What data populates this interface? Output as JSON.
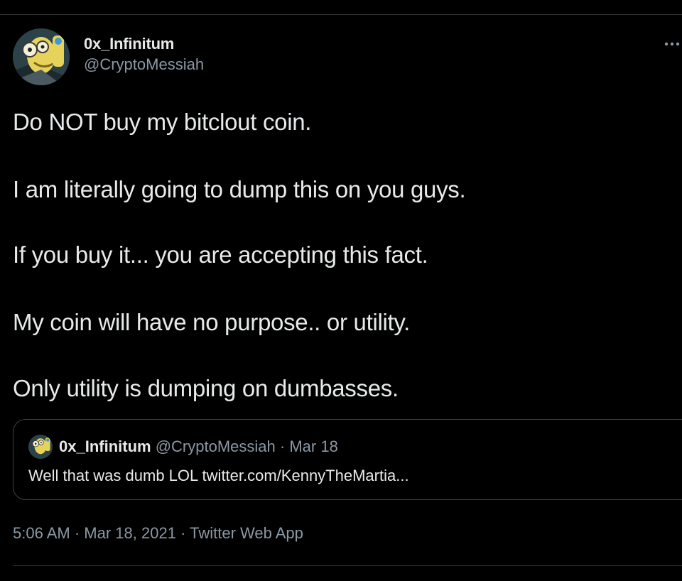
{
  "tweet": {
    "author": {
      "display_name": "0x_Infinitum",
      "handle": "@CryptoMessiah"
    },
    "more_icon": "more-horizontal-icon",
    "text_lines": [
      "Do NOT buy my bitclout coin.",
      "I am literally going to dump this on you guys.",
      "If you buy it... you are accepting this fact.",
      "My coin will have no purpose.. or utility.",
      "Only utility is dumping on dumbasses."
    ],
    "quote": {
      "display_name": "0x_Infinitum",
      "handle": "@CryptoMessiah",
      "separator": "·",
      "date": "Mar 18",
      "text": "Well that was dumb LOL twitter.com/KennyTheMartia..."
    },
    "meta": {
      "time": "5:06 AM",
      "separator": "·",
      "date": "Mar 18, 2021",
      "source": "Twitter Web App"
    }
  },
  "colors": {
    "background": "#000000",
    "primary_text": "#e7e9ea",
    "secondary_text": "#8b98a5",
    "border": "#3e4144"
  }
}
